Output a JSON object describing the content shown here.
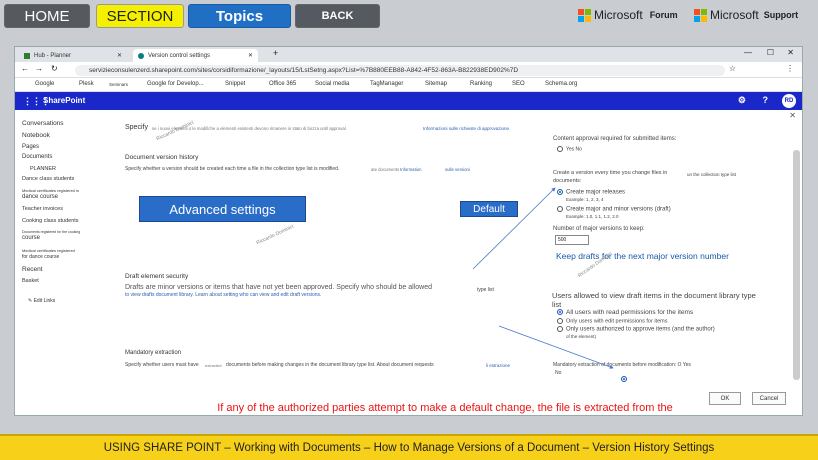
{
  "nav": {
    "home": "HOME",
    "section": "SECTION",
    "topics": "Topics",
    "back": "BACK"
  },
  "ms_forum": {
    "brand": "Microsoft",
    "label": "Forum"
  },
  "ms_support": {
    "brand": "Microsoft",
    "label": "Support"
  },
  "browser": {
    "tab1": "Hub - Planner",
    "tab2": "Version control settings",
    "url": "servizieconsulenzerd.sharepoint.com/sites/corsidiformazione/_layouts/15/LstSetng.aspx?List=%7B880EEB88-A842-4F52-863A-B822938ED902%7D",
    "bookmarks": [
      "Google",
      "Plesk",
      "Seminars",
      "Google for Develop...",
      "Snippet",
      "Office 365",
      "Social media",
      "TagManager",
      "Sitemap",
      "Ranking",
      "SEO",
      "Schema.org"
    ]
  },
  "sharepoint": {
    "brand": "SharePoint",
    "avatar": "RD"
  },
  "left_nav": [
    "Conversations",
    "Notebook",
    "Pages",
    "Documents",
    "PLANNER",
    "Dance class students",
    "Medical certificates registered in",
    "dance course",
    "Teacher invoices",
    "Cooking class students",
    "Documents registered for the cooking",
    "course",
    "Medical certificates registered",
    "for dance course",
    "Recent",
    "Basket",
    "Edit Links"
  ],
  "page": {
    "specify_label": "Specify",
    "specify_text": "se i nuovi elementi o le modifiche a elementi esistenti devono rimanere in stato di bozza until approval",
    "approval_info": "Informazioni sulle richieste di approvazione.",
    "doc_version_title": "Document version history",
    "doc_version_text": "Specify whether a version should be created each time a file in the collection type list is modified.",
    "doc_version_link1": "ate documents",
    "doc_version_link2": "Information",
    "doc_version_link3": "sulle versioni",
    "draft_title": "Draft element security",
    "draft_text": "Drafts are minor versions or items that have not yet been approved. Specify who should be allowed",
    "draft_text2": "to view drafts document library. Learn about setting who can view and edit draft versions.",
    "draft_type": "type list",
    "mandatory_title": "Mandatory extraction",
    "mandatory_text": "Specify whether users must have",
    "mandatory_text_b": "extracted",
    "mandatory_text2": "documents before making changes in the document library type list. About document requests",
    "mandatory_link": "li estrazione",
    "content_approval": "Content approval required for submitted items:",
    "yes_no": "Yes No",
    "create_version": "Create a version every time you change files in",
    "create_version2": "un the collection type list",
    "documents_label": "documents:",
    "opt_major": "Create major releases",
    "opt_major_ex": "Example: 1, 2, 3, 4",
    "opt_minor": "Create major and minor versions (draft)",
    "opt_minor_ex": "Example: 1.0, 1.1, 1.2, 2.0",
    "num_major": "Number of major versions to keep:",
    "num_major_value": "500",
    "keep_drafts": "Keep drafts for the next major version number",
    "users_view": "Users allowed to view draft items in the document library type",
    "users_view2": "list",
    "opt_all_read": "All users with read permissions for the items",
    "opt_edit": "Only users with edit permissions for items",
    "opt_approve": "Only users authorized to approve items (and the author)",
    "opt_approve2": "of the element)",
    "mandatory_q": "Mandatory extraction of documents before modification: O Yes",
    "no": "No",
    "ok": "OK",
    "cancel": "Cancel"
  },
  "annotations": {
    "advanced": "Advanced settings",
    "default": "Default",
    "red_note": "If any of the authorized parties attempt to make a default change, the file is extracted from the archive and must be made available by those who have complete control of it",
    "watermark": "Riccardo Dominici"
  },
  "footer": "USING SHARE POINT – Working with Documents – How to Manage Versions of a Document – Version History Settings",
  "colors": {
    "accent": "#1f6fc4",
    "sharepoint_bar": "#1a28c9",
    "section": "#f4f000",
    "footer": "#f7d01a",
    "annotation_box": "#2a6dc8",
    "red_note": "#e11111"
  }
}
